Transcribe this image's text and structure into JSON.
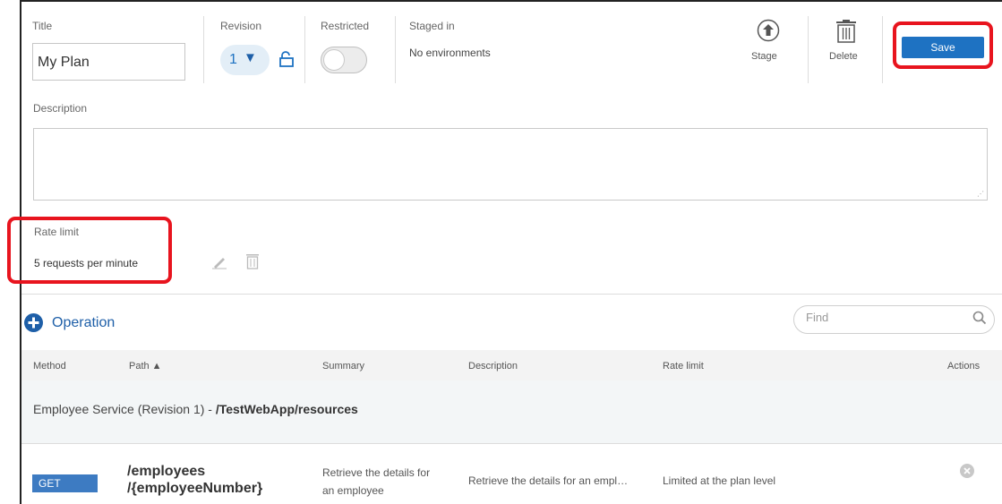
{
  "header": {
    "title_label": "Title",
    "title_value": "My Plan",
    "revision_label": "Revision",
    "revision_value": "1",
    "revision_caret": "▼",
    "restricted_label": "Restricted",
    "restricted_on": false,
    "staged_label": "Staged in",
    "staged_value": "No environments",
    "stage_label": "Stage",
    "delete_label": "Delete",
    "save_label": "Save"
  },
  "description": {
    "label": "Description",
    "value": ""
  },
  "rate_limit": {
    "label": "Rate limit",
    "value": "5 requests per minute"
  },
  "operations": {
    "add_label": "Operation",
    "find_placeholder": "Find",
    "columns": {
      "method": "Method",
      "path": "Path ▲",
      "summary": "Summary",
      "description": "Description",
      "rate_limit": "Rate limit",
      "actions": "Actions"
    },
    "group": {
      "service": "Employee Service (Revision 1) - ",
      "base_path": "/TestWebApp/resources"
    },
    "rows": [
      {
        "method": "GET",
        "path_line1": "/employees",
        "path_line2": "/{employeeNumber}",
        "summary_line1": "Retrieve the details for",
        "summary_line2": "an employee",
        "description": "Retrieve the details for an empl…",
        "rate_limit": "Limited at the plan level"
      }
    ]
  },
  "colors": {
    "accent": "#1e72c2",
    "highlight": "#e8141e",
    "get_badge": "#3d7bc2"
  }
}
